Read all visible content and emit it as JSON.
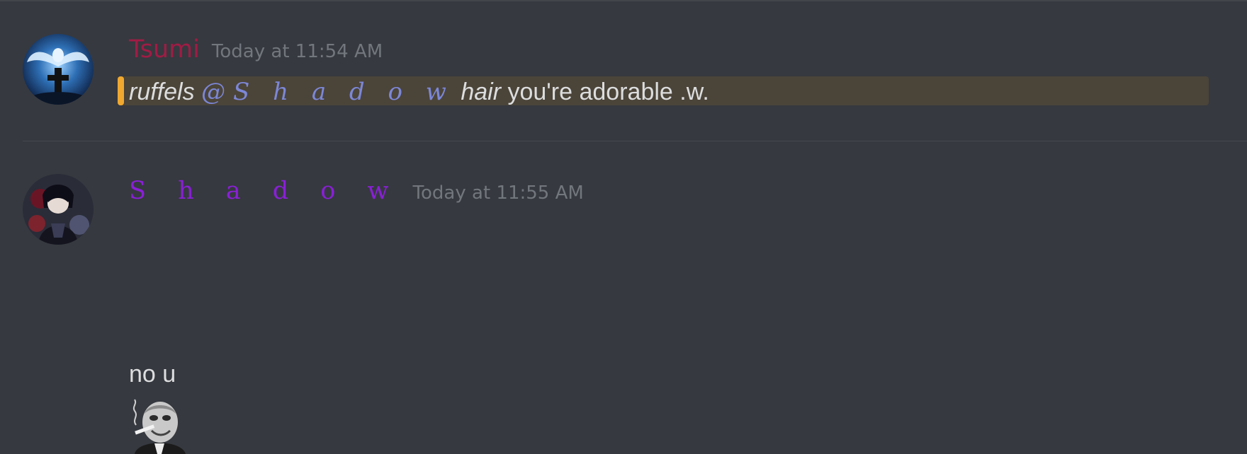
{
  "messages": [
    {
      "author": "Tsumi",
      "timestamp": "Today at 11:54 AM",
      "mentions_me": true,
      "content": {
        "action_start": "ruffels",
        "mention": "@S h a d o w",
        "action_end": "hair",
        "text": " you're adorable .w."
      }
    },
    {
      "author": "S h a d o w",
      "timestamp": "Today at 11:55 AM",
      "content": {
        "text": "no u"
      },
      "emoji": "cigar-man-emoji"
    }
  ],
  "colors": {
    "background": "#36393f",
    "tsumi_name": "#a01c45",
    "shadow_name": "#8a1fd8",
    "mention_text": "#7c87d8",
    "mention_highlight": "#4b4439",
    "mention_bar": "#f0a830",
    "timestamp": "#72767d",
    "message_text": "#dcddde"
  }
}
